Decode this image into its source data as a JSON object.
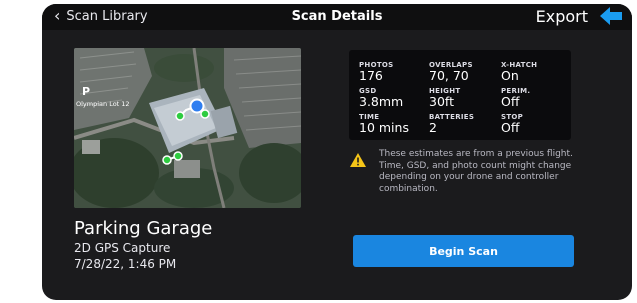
{
  "nav": {
    "back_label": "Scan Library",
    "title": "Scan Details",
    "export_label": "Export",
    "back_icon": "chevron-left-icon",
    "export_icon": "arrow-left-icon",
    "accent_color": "#1a9cf0"
  },
  "map": {
    "poi_label": "Olympian Lot 12",
    "parking_symbol": "P",
    "waypoint_color": "#2ecc40",
    "current_position_color": "#2f7ef0"
  },
  "site": {
    "title": "Parking Garage",
    "capture_type": "2D GPS Capture",
    "date": "7/28/22, 1:46 PM"
  },
  "stats": [
    {
      "label": "PHOTOS",
      "value": "176"
    },
    {
      "label": "OVERLAPS",
      "value": "70, 70"
    },
    {
      "label": "X-HATCH",
      "value": "On"
    },
    {
      "label": "GSD",
      "value": "3.8mm"
    },
    {
      "label": "HEIGHT",
      "value": "30ft"
    },
    {
      "label": "PERIM.",
      "value": "Off"
    },
    {
      "label": "TIME",
      "value": "10 mins"
    },
    {
      "label": "BATTERIES",
      "value": "2"
    },
    {
      "label": "STOP",
      "value": "Off"
    }
  ],
  "warning": {
    "icon": "warning-icon",
    "text": "These estimates are from a previous flight. Time, GSD, and photo count might change depending on your drone and controller combination.",
    "color": "#f5c518"
  },
  "actions": {
    "begin_scan_label": "Begin Scan",
    "begin_scan_color": "#1a86e0"
  }
}
